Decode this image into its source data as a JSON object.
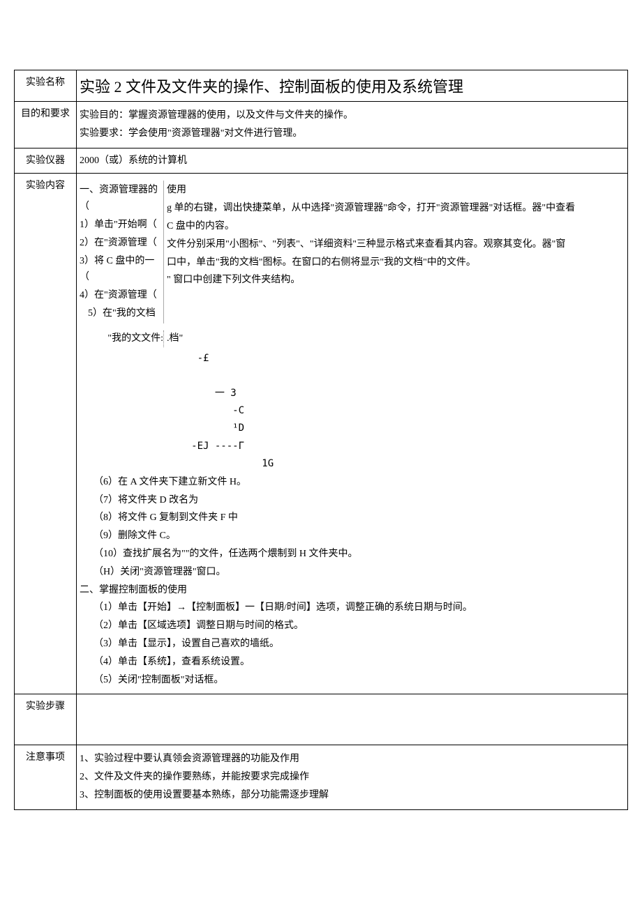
{
  "rows": {
    "name": {
      "label": "实验名称",
      "value": "实验 2 文件及文件夹的操作、控制面板的使用及系统管理"
    },
    "purpose": {
      "label": "目的和要求",
      "line1": "实验目的：掌握资源管理器的使用，以及文件与文件夹的操作。",
      "line2": "实验要求：学会使用\"资源管理器\"对文件进行管理。"
    },
    "equipment": {
      "label": "实验仪器",
      "value": "2000（或）系统的计算机"
    },
    "content": {
      "label": "实验内容",
      "leftLines": [
        "一、资源管理器的（",
        "1）单击\"开始啊（",
        "2）在\"资源管理（",
        "3）将 C 盘中的一（",
        "4）在\"资源管理（",
        "5）在\"我的文档"
      ],
      "rightLines": [
        "使用",
        "g 单的右键，调出快捷菜单，从中选择\"资源管理器\"命令，打开\"资源管理器\"对话框。器\"中查看",
        "C 盘中的内容。",
        "文件分别采用\"小图标\"、\"列表\"、\"详细资料''三种显示格式来查看其内容。观察其变化。器\"窗",
        "口中，单击\"我的文档\"图标。在窗口的右侧将显示\"我的文档\"中的文件。",
        "\" 窗口中创建下列文件夹结构。"
      ],
      "treeHeaderLeft": "\"我的文文件:",
      "treeHeaderRight": ".档\"",
      "treeLines": [
        "                    -£",
        "",
        "                       一 3",
        "                          -C",
        "                          ¹D",
        "                   -EJ ----Γ",
        "                               1G"
      ],
      "afterTree": [
        "（6）在 A 文件夹下建立新文件 H。",
        "（7）将文件夹 D 改名为",
        "（8）将文件 G 复制到文件夹 F 中",
        "（9）删除文件 C。",
        "（10）查找扩展名为\"\"的文件，任选两个煨制到 H 文件夹中。",
        "（H）关闭\"资源管理器\"窗口。",
        "二、掌握控制面板的使用",
        "（1）单击【开始】→【控制面板】一【日期/时间】选项，调整正确的系统日期与时间。",
        "（2）单击【区域选项】调整日期与时间的格式。",
        "（3）单击【显示】，设置自己喜欢的墙纸。",
        "（4）单击【系统】，查看系统设置。",
        "（5）关闭\"控制面板\"对话框。"
      ]
    },
    "steps": {
      "label": "实验步骤",
      "value": ""
    },
    "notes": {
      "label": "注意事项",
      "lines": [
        "1、实验过程中要认真领会资源管理器的功能及作用",
        "2、文件及文件夹的操作要熟练，并能按要求完成操作",
        "3、控制面板的使用设置要基本熟练，部分功能需逐步理解"
      ]
    }
  }
}
